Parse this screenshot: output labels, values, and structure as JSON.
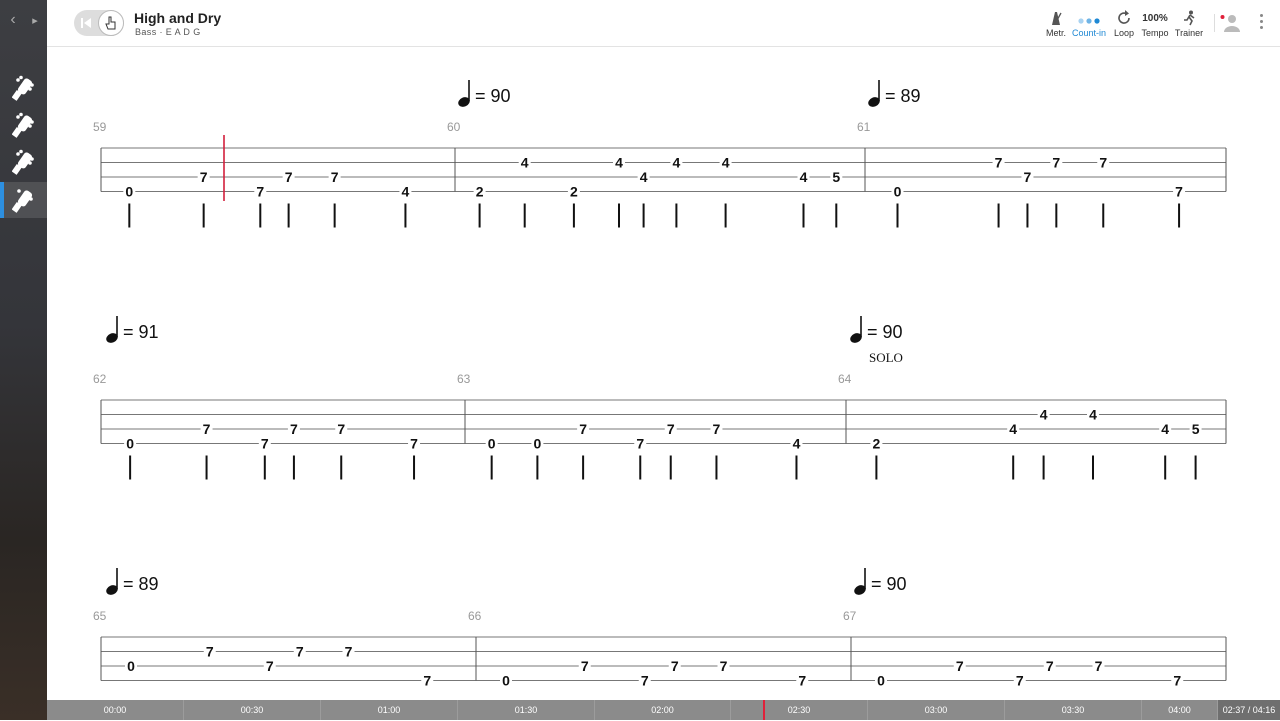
{
  "header": {
    "song_title": "High and Dry",
    "track_info": "Bass · E A D G",
    "tools": [
      {
        "id": "metronome",
        "label": "Metr.",
        "icon": "metronome-icon",
        "active": false
      },
      {
        "id": "count-in",
        "label": "Count-in",
        "icon": "count-in-icon",
        "active": true
      },
      {
        "id": "loop",
        "label": "Loop",
        "icon": "loop-icon",
        "active": false
      },
      {
        "id": "tempo",
        "label": "Tempo",
        "value": "100%",
        "active": false
      },
      {
        "id": "trainer",
        "label": "Trainer",
        "icon": "trainer-icon",
        "active": false
      }
    ]
  },
  "sidebar": {
    "tracks": [
      {
        "icon": "guitar-headstock-icon",
        "active": false
      },
      {
        "icon": "guitar-headstock-icon",
        "active": false
      },
      {
        "icon": "guitar-headstock-icon",
        "active": false
      },
      {
        "icon": "bass-headstock-icon",
        "active": true
      }
    ]
  },
  "score": {
    "systems": [
      {
        "tempos": [
          {
            "value": "= 90",
            "measure_index": 1
          },
          {
            "value": "= 89",
            "measure_index": 2
          }
        ],
        "measures": [
          {
            "number": "59",
            "notes": [
              {
                "fret": "0",
                "string": 3,
                "pos": 0.08
              },
              {
                "fret": "7",
                "string": 2,
                "pos": 0.29
              },
              {
                "fret": "7",
                "string": 3,
                "pos": 0.45
              },
              {
                "fret": "7",
                "string": 2,
                "pos": 0.53
              },
              {
                "fret": "7",
                "string": 2,
                "pos": 0.66
              },
              {
                "fret": "4",
                "string": 3,
                "pos": 0.86
              }
            ]
          },
          {
            "number": "60",
            "notes": [
              {
                "fret": "2",
                "string": 3,
                "pos": 0.06
              },
              {
                "fret": "4",
                "string": 1,
                "pos": 0.17
              },
              {
                "fret": "2",
                "string": 3,
                "pos": 0.29
              },
              {
                "fret": "4",
                "string": 1,
                "pos": 0.4
              },
              {
                "fret": "4",
                "string": 2,
                "pos": 0.46
              },
              {
                "fret": "4",
                "string": 1,
                "pos": 0.54
              },
              {
                "fret": "4",
                "string": 1,
                "pos": 0.66
              },
              {
                "fret": "4",
                "string": 2,
                "pos": 0.85
              },
              {
                "fret": "5",
                "string": 2,
                "pos": 0.93
              }
            ]
          },
          {
            "number": "61",
            "notes": [
              {
                "fret": "0",
                "string": 3,
                "pos": 0.09
              },
              {
                "fret": "7",
                "string": 1,
                "pos": 0.37
              },
              {
                "fret": "7",
                "string": 2,
                "pos": 0.45
              },
              {
                "fret": "7",
                "string": 1,
                "pos": 0.53
              },
              {
                "fret": "7",
                "string": 1,
                "pos": 0.66
              },
              {
                "fret": "7",
                "string": 3,
                "pos": 0.87
              }
            ]
          }
        ]
      },
      {
        "tempos": [
          {
            "value": "= 91",
            "measure_index": 0
          },
          {
            "value": "= 90",
            "measure_index": 2
          }
        ],
        "text": "SOLO",
        "measures": [
          {
            "number": "62",
            "notes": [
              {
                "fret": "0",
                "string": 3,
                "pos": 0.08
              },
              {
                "fret": "7",
                "string": 2,
                "pos": 0.29
              },
              {
                "fret": "7",
                "string": 3,
                "pos": 0.45
              },
              {
                "fret": "7",
                "string": 2,
                "pos": 0.53
              },
              {
                "fret": "7",
                "string": 2,
                "pos": 0.66
              },
              {
                "fret": "7",
                "string": 3,
                "pos": 0.86
              }
            ]
          },
          {
            "number": "63",
            "notes": [
              {
                "fret": "0",
                "string": 3,
                "pos": 0.07
              },
              {
                "fret": "0",
                "string": 3,
                "pos": 0.19
              },
              {
                "fret": "7",
                "string": 2,
                "pos": 0.31
              },
              {
                "fret": "7",
                "string": 3,
                "pos": 0.46
              },
              {
                "fret": "7",
                "string": 2,
                "pos": 0.54
              },
              {
                "fret": "7",
                "string": 2,
                "pos": 0.66
              },
              {
                "fret": "4",
                "string": 3,
                "pos": 0.87
              }
            ]
          },
          {
            "number": "64",
            "notes": [
              {
                "fret": "2",
                "string": 3,
                "pos": 0.08
              },
              {
                "fret": "4",
                "string": 2,
                "pos": 0.44
              },
              {
                "fret": "4",
                "string": 1,
                "pos": 0.52
              },
              {
                "fret": "4",
                "string": 1,
                "pos": 0.65
              },
              {
                "fret": "4",
                "string": 2,
                "pos": 0.84
              },
              {
                "fret": "5",
                "string": 2,
                "pos": 0.92
              }
            ]
          }
        ]
      },
      {
        "tempos": [
          {
            "value": "= 89",
            "measure_index": 0
          },
          {
            "value": "= 90",
            "measure_index": 2
          }
        ],
        "measures": [
          {
            "number": "65",
            "notes": [
              {
                "fret": "0",
                "string": 2,
                "pos": 0.08
              },
              {
                "fret": "7",
                "string": 1,
                "pos": 0.29
              },
              {
                "fret": "7",
                "string": 2,
                "pos": 0.45
              },
              {
                "fret": "7",
                "string": 1,
                "pos": 0.53
              },
              {
                "fret": "7",
                "string": 1,
                "pos": 0.66
              },
              {
                "fret": "7",
                "string": 3,
                "pos": 0.87
              }
            ]
          },
          {
            "number": "66",
            "notes": [
              {
                "fret": "0",
                "string": 3,
                "pos": 0.08
              },
              {
                "fret": "7",
                "string": 2,
                "pos": 0.29
              },
              {
                "fret": "7",
                "string": 3,
                "pos": 0.45
              },
              {
                "fret": "7",
                "string": 2,
                "pos": 0.53
              },
              {
                "fret": "7",
                "string": 2,
                "pos": 0.66
              },
              {
                "fret": "7",
                "string": 3,
                "pos": 0.87
              }
            ]
          },
          {
            "number": "67",
            "notes": [
              {
                "fret": "0",
                "string": 3,
                "pos": 0.08
              },
              {
                "fret": "7",
                "string": 2,
                "pos": 0.29
              },
              {
                "fret": "7",
                "string": 3,
                "pos": 0.45
              },
              {
                "fret": "7",
                "string": 2,
                "pos": 0.53
              },
              {
                "fret": "7",
                "string": 2,
                "pos": 0.66
              },
              {
                "fret": "7",
                "string": 3,
                "pos": 0.87
              }
            ]
          }
        ]
      }
    ]
  },
  "timeline": {
    "ticks": [
      "00:00",
      "00:30",
      "01:00",
      "01:30",
      "02:00",
      "02:30",
      "03:00",
      "03:30",
      "04:00"
    ],
    "current_time": "02:37 / 04:16",
    "progress": 0.61
  },
  "colors": {
    "accent": "#1e88d4",
    "cursor": "#d21f3c",
    "timeline_bg": "#8b8b8b"
  }
}
